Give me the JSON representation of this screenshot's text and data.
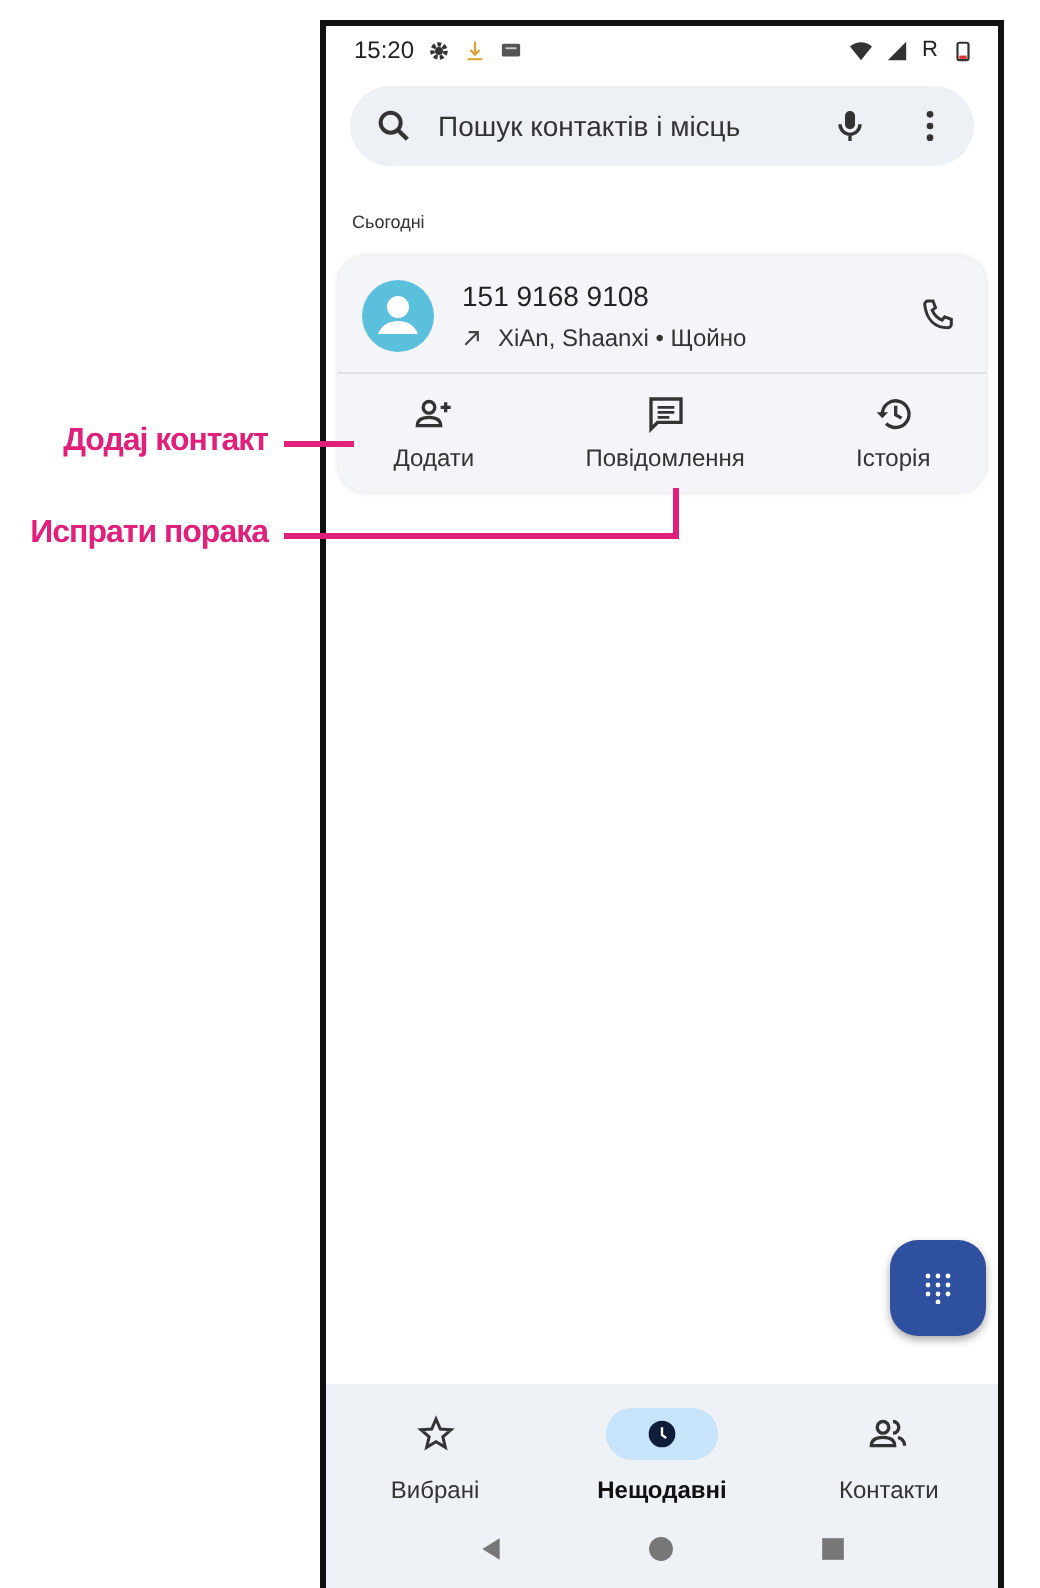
{
  "status_bar": {
    "time": "15:20",
    "network_label": "R"
  },
  "search": {
    "placeholder": "Пошук контактів і місць"
  },
  "section_title": "Сьогодні",
  "call": {
    "number": "151 9168 9108",
    "detail": "XiAn, Shaanxi • Щойно"
  },
  "actions": [
    {
      "kind": "add",
      "label": "Додати"
    },
    {
      "kind": "message",
      "label": "Повідомлення"
    },
    {
      "kind": "history",
      "label": "Історія"
    }
  ],
  "nav_tabs": [
    {
      "kind": "favorites",
      "label": "Вибрані",
      "selected": false
    },
    {
      "kind": "recent",
      "label": "Нещодавні",
      "selected": true
    },
    {
      "kind": "contacts",
      "label": "Контакти",
      "selected": false
    }
  ],
  "annotations": [
    {
      "text": "Додај контакт"
    },
    {
      "text": "Испрати порака"
    }
  ]
}
